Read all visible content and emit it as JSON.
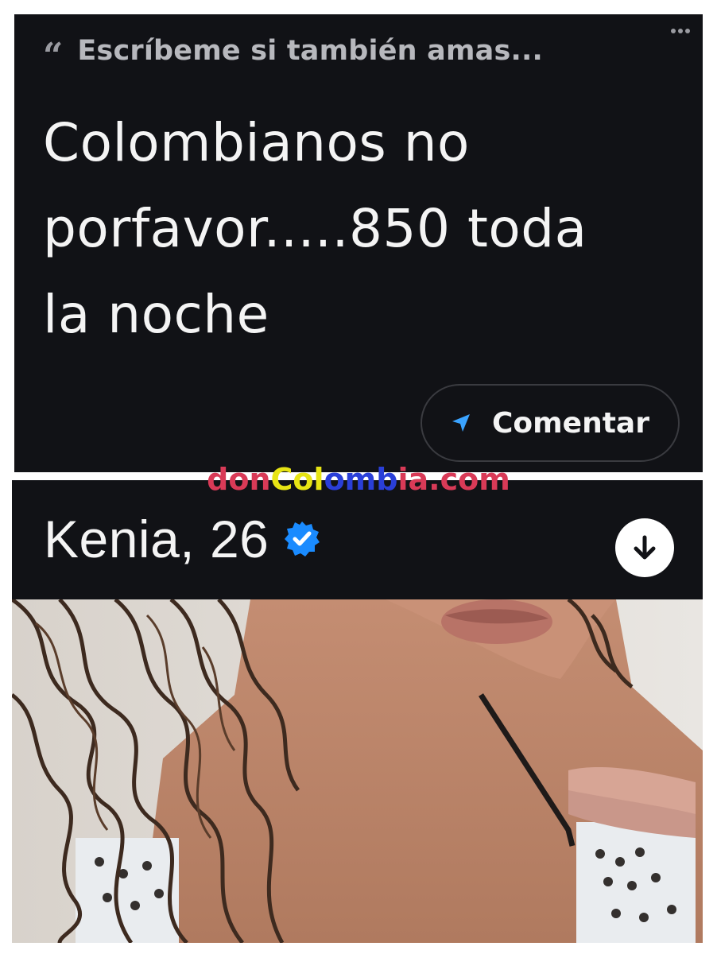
{
  "prompt": {
    "quote_icon": "quote-icon",
    "title": "Escríbeme si también amas..."
  },
  "answer": {
    "lines": [
      "Colombianos no",
      "porfavor.....850 toda",
      "la noche"
    ]
  },
  "comment_button": {
    "icon": "send-icon",
    "label": "Comentar"
  },
  "watermark": {
    "part1": "don",
    "part2": "Col",
    "part3": "omb",
    "part4": "ia.com"
  },
  "profile": {
    "name_age": "Kenia, 26",
    "verified_icon": "verified-badge-icon",
    "down_icon": "arrow-down-icon"
  },
  "colors": {
    "panel_bg": "#111216",
    "verified_blue": "#1a8bff",
    "send_blue": "#3aa3ff"
  }
}
